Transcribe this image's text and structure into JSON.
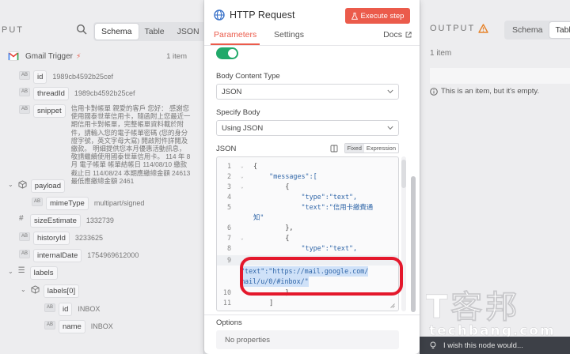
{
  "input_panel": {
    "title": "PUT",
    "tabs": [
      "Schema",
      "Table",
      "JSON"
    ],
    "active_tab": "Schema",
    "trigger": {
      "name": "Gmail Trigger",
      "count": "1 item"
    },
    "fields": {
      "id": {
        "name": "id",
        "value": "1989cb4592b25cef"
      },
      "thread_id": {
        "name": "threadId",
        "value": "1989cb4592b25cef"
      },
      "snippet": {
        "name": "snippet",
        "value": "信用卡對帳單 親愛的客戶 您好： 感謝您使用國泰世華信用卡，隨函附上您最近一期信用卡對帳單，完整帳單資料載於附件，請輸入您的電子帳單密碼 (您的身分證字號，英文字母大寫) 開啟附件詳閱及繳款。 明細提供您本月優惠活動訊息，敬請繼續使用國泰世華信用卡。 114 年 8 月 電子帳單 帳單結帳日 114/08/10 繳款截止日 114/08/24 本期應繳總金額 24613 最低應繳總金額 2461"
      },
      "payload": {
        "name": "payload"
      },
      "mime_type": {
        "name": "mimeType",
        "value": "multipart/signed"
      },
      "size_estimate": {
        "name": "sizeEstimate",
        "value": "1332739"
      },
      "history_id": {
        "name": "historyId",
        "value": "3233625"
      },
      "internal_date": {
        "name": "internalDate",
        "value": "1754969612000"
      },
      "labels": {
        "name": "labels"
      },
      "labels0": {
        "name": "labels[0]"
      },
      "label_id": {
        "name": "id",
        "value": "INBOX"
      },
      "label_name": {
        "name": "name",
        "value": "INBOX"
      }
    },
    "badges": {
      "ab": "AB",
      "hash": "#"
    }
  },
  "node": {
    "title": "HTTP Request",
    "execute_label": "Execute step",
    "tabs": {
      "parameters": "Parameters",
      "settings": "Settings",
      "docs": "Docs"
    },
    "body_content_type": {
      "label": "Body Content Type",
      "value": "JSON"
    },
    "specify_body": {
      "label": "Specify Body",
      "value": "Using JSON"
    },
    "json_label": "JSON",
    "mode": {
      "fixed": "Fixed",
      "expression": "Expression"
    },
    "code_lines": [
      {
        "n": "1",
        "text": "{"
      },
      {
        "n": "2",
        "text": "    \"messages\":["
      },
      {
        "n": "3",
        "text": "        {"
      },
      {
        "n": "4",
        "text": "            \"type\":\"text\","
      },
      {
        "n": "5",
        "text": "            \"text\":\"信用卡繳費通"
      },
      {
        "n": "",
        "text": "知\""
      },
      {
        "n": "6",
        "text": "        },"
      },
      {
        "n": "7",
        "text": "        {"
      },
      {
        "n": "8",
        "text": "            \"type\":\"text\","
      },
      {
        "n": "9",
        "text": ""
      },
      {
        "n": "",
        "text": "\"text\":\"https://mail.google.com/"
      },
      {
        "n": "",
        "text": "mail/u/0/#inbox/\""
      },
      {
        "n": "10",
        "text": "        }"
      },
      {
        "n": "11",
        "text": "    ]"
      }
    ],
    "options_label": "Options",
    "no_properties": "No properties"
  },
  "output_panel": {
    "title": "OUTPUT",
    "tabs": [
      "Schema",
      "Table"
    ],
    "active_tab": "Table",
    "count": "1 item",
    "info": "This is an item, but it's empty.",
    "feedback": "I wish this node would..."
  },
  "watermark": {
    "logo": "T客邦",
    "url": "techbang.com"
  },
  "colors": {
    "accent": "#eb5b4b",
    "toggle": "#21a96a",
    "highlight": "#e4182c"
  }
}
